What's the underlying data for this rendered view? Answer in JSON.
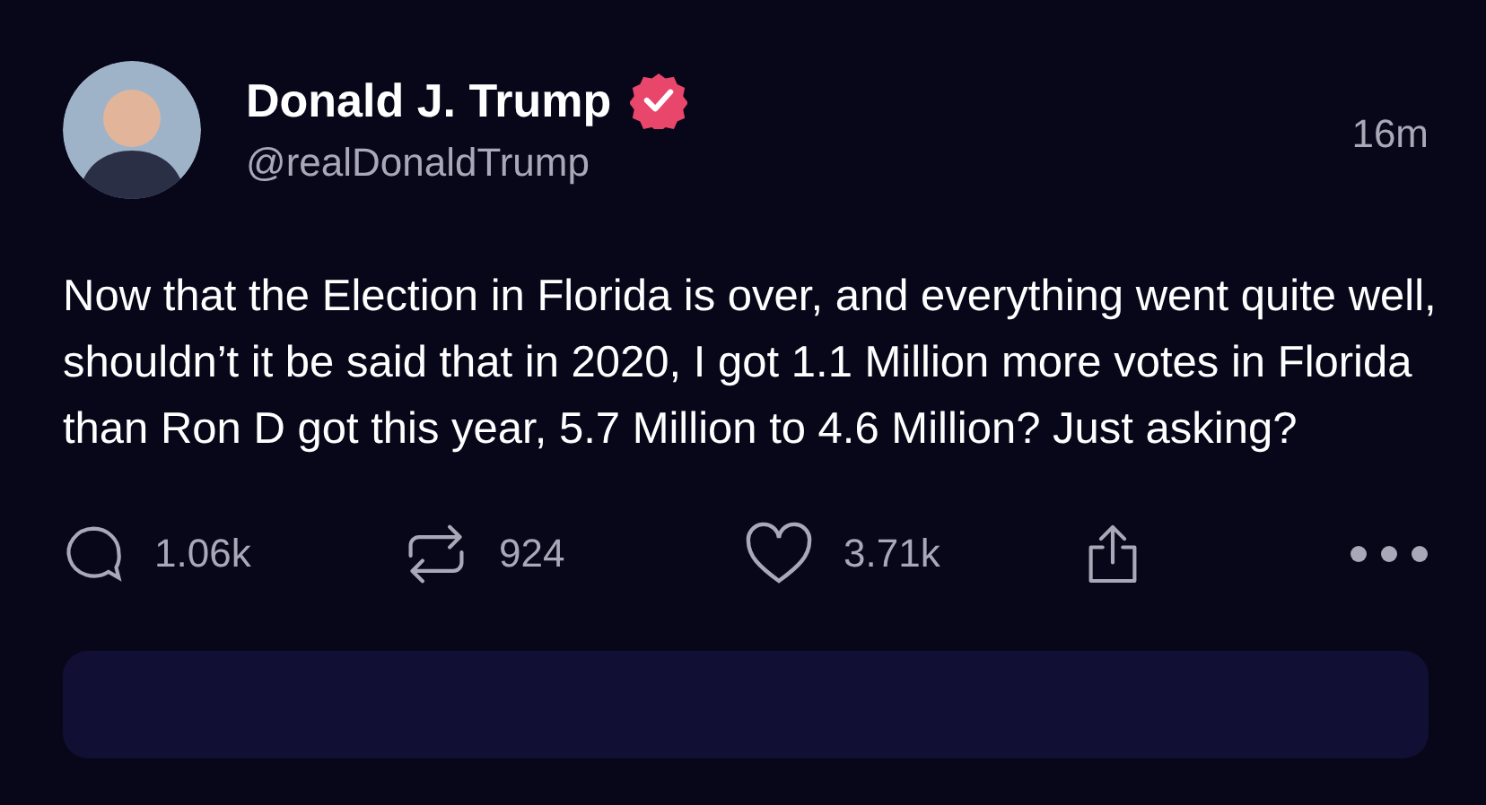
{
  "post": {
    "author": {
      "name": "Donald J. Trump",
      "handle": "@realDonaldTrump",
      "verified": true
    },
    "time": "16m",
    "text": "Now that the Election in Florida is over, and everything went quite well, shouldn’t it be said that in 2020, I got 1.1 Million more votes in Florida than Ron D got this year, 5.7 Million to 4.6 Million? Just asking?",
    "actions": [
      {
        "kind": "reply",
        "count": "1.06k"
      },
      {
        "kind": "repost",
        "count": "924"
      },
      {
        "kind": "like",
        "count": "3.71k"
      },
      {
        "kind": "share"
      }
    ]
  }
}
